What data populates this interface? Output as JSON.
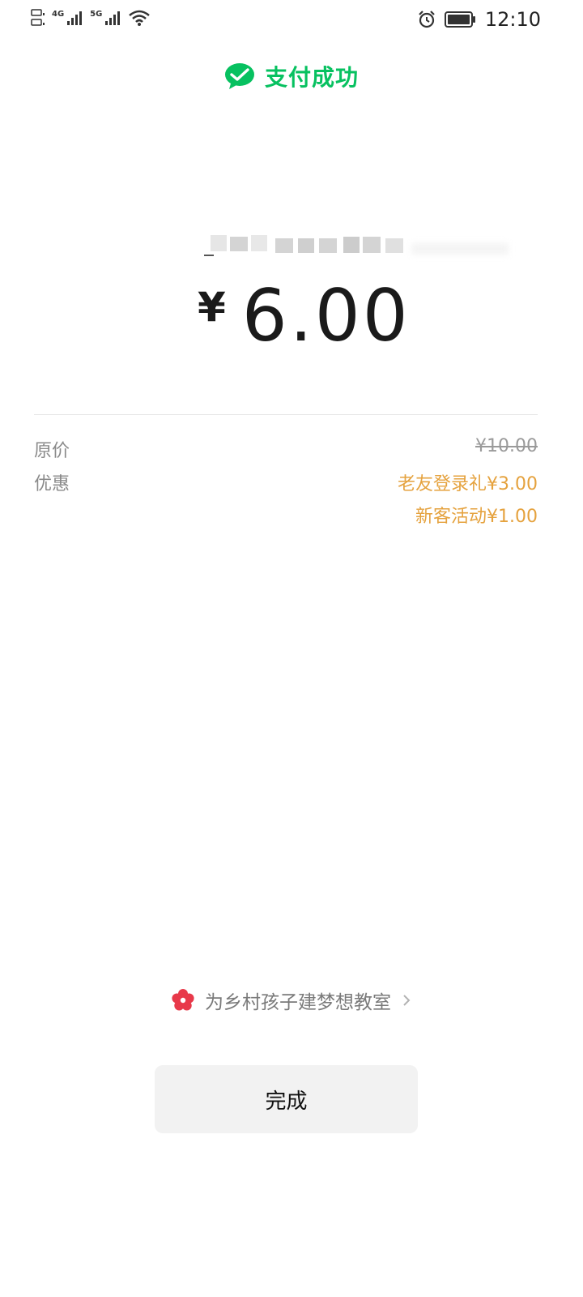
{
  "status_bar": {
    "time": "12:10",
    "network_1": "4G",
    "network_2": "5G"
  },
  "header": {
    "title": "支付成功",
    "brand_color": "#07C160"
  },
  "payment": {
    "currency": "¥",
    "amount": "6.00"
  },
  "details": {
    "original_price_label": "原价",
    "original_price_value": "¥10.00",
    "discount_label": "优惠",
    "discounts": [
      "老友登录礼¥3.00",
      "新客活动¥1.00"
    ]
  },
  "donation": {
    "text": "为乡村孩子建梦想教室"
  },
  "done_button": {
    "label": "完成"
  },
  "colors": {
    "discount": "#E5A23E",
    "button_bg": "#F2F2F2"
  }
}
